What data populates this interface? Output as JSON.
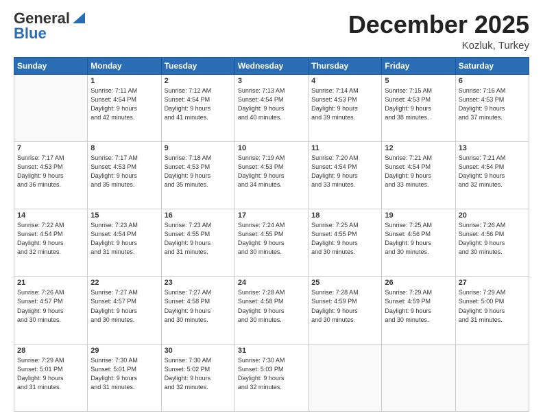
{
  "logo": {
    "line1": "General",
    "line2": "Blue"
  },
  "header": {
    "month": "December 2025",
    "location": "Kozluk, Turkey"
  },
  "weekdays": [
    "Sunday",
    "Monday",
    "Tuesday",
    "Wednesday",
    "Thursday",
    "Friday",
    "Saturday"
  ],
  "weeks": [
    [
      {
        "day": "",
        "info": ""
      },
      {
        "day": "1",
        "info": "Sunrise: 7:11 AM\nSunset: 4:54 PM\nDaylight: 9 hours\nand 42 minutes."
      },
      {
        "day": "2",
        "info": "Sunrise: 7:12 AM\nSunset: 4:54 PM\nDaylight: 9 hours\nand 41 minutes."
      },
      {
        "day": "3",
        "info": "Sunrise: 7:13 AM\nSunset: 4:54 PM\nDaylight: 9 hours\nand 40 minutes."
      },
      {
        "day": "4",
        "info": "Sunrise: 7:14 AM\nSunset: 4:53 PM\nDaylight: 9 hours\nand 39 minutes."
      },
      {
        "day": "5",
        "info": "Sunrise: 7:15 AM\nSunset: 4:53 PM\nDaylight: 9 hours\nand 38 minutes."
      },
      {
        "day": "6",
        "info": "Sunrise: 7:16 AM\nSunset: 4:53 PM\nDaylight: 9 hours\nand 37 minutes."
      }
    ],
    [
      {
        "day": "7",
        "info": "Sunrise: 7:17 AM\nSunset: 4:53 PM\nDaylight: 9 hours\nand 36 minutes."
      },
      {
        "day": "8",
        "info": "Sunrise: 7:17 AM\nSunset: 4:53 PM\nDaylight: 9 hours\nand 35 minutes."
      },
      {
        "day": "9",
        "info": "Sunrise: 7:18 AM\nSunset: 4:53 PM\nDaylight: 9 hours\nand 35 minutes."
      },
      {
        "day": "10",
        "info": "Sunrise: 7:19 AM\nSunset: 4:53 PM\nDaylight: 9 hours\nand 34 minutes."
      },
      {
        "day": "11",
        "info": "Sunrise: 7:20 AM\nSunset: 4:54 PM\nDaylight: 9 hours\nand 33 minutes."
      },
      {
        "day": "12",
        "info": "Sunrise: 7:21 AM\nSunset: 4:54 PM\nDaylight: 9 hours\nand 33 minutes."
      },
      {
        "day": "13",
        "info": "Sunrise: 7:21 AM\nSunset: 4:54 PM\nDaylight: 9 hours\nand 32 minutes."
      }
    ],
    [
      {
        "day": "14",
        "info": "Sunrise: 7:22 AM\nSunset: 4:54 PM\nDaylight: 9 hours\nand 32 minutes."
      },
      {
        "day": "15",
        "info": "Sunrise: 7:23 AM\nSunset: 4:54 PM\nDaylight: 9 hours\nand 31 minutes."
      },
      {
        "day": "16",
        "info": "Sunrise: 7:23 AM\nSunset: 4:55 PM\nDaylight: 9 hours\nand 31 minutes."
      },
      {
        "day": "17",
        "info": "Sunrise: 7:24 AM\nSunset: 4:55 PM\nDaylight: 9 hours\nand 30 minutes."
      },
      {
        "day": "18",
        "info": "Sunrise: 7:25 AM\nSunset: 4:55 PM\nDaylight: 9 hours\nand 30 minutes."
      },
      {
        "day": "19",
        "info": "Sunrise: 7:25 AM\nSunset: 4:56 PM\nDaylight: 9 hours\nand 30 minutes."
      },
      {
        "day": "20",
        "info": "Sunrise: 7:26 AM\nSunset: 4:56 PM\nDaylight: 9 hours\nand 30 minutes."
      }
    ],
    [
      {
        "day": "21",
        "info": "Sunrise: 7:26 AM\nSunset: 4:57 PM\nDaylight: 9 hours\nand 30 minutes."
      },
      {
        "day": "22",
        "info": "Sunrise: 7:27 AM\nSunset: 4:57 PM\nDaylight: 9 hours\nand 30 minutes."
      },
      {
        "day": "23",
        "info": "Sunrise: 7:27 AM\nSunset: 4:58 PM\nDaylight: 9 hours\nand 30 minutes."
      },
      {
        "day": "24",
        "info": "Sunrise: 7:28 AM\nSunset: 4:58 PM\nDaylight: 9 hours\nand 30 minutes."
      },
      {
        "day": "25",
        "info": "Sunrise: 7:28 AM\nSunset: 4:59 PM\nDaylight: 9 hours\nand 30 minutes."
      },
      {
        "day": "26",
        "info": "Sunrise: 7:29 AM\nSunset: 4:59 PM\nDaylight: 9 hours\nand 30 minutes."
      },
      {
        "day": "27",
        "info": "Sunrise: 7:29 AM\nSunset: 5:00 PM\nDaylight: 9 hours\nand 31 minutes."
      }
    ],
    [
      {
        "day": "28",
        "info": "Sunrise: 7:29 AM\nSunset: 5:01 PM\nDaylight: 9 hours\nand 31 minutes."
      },
      {
        "day": "29",
        "info": "Sunrise: 7:30 AM\nSunset: 5:01 PM\nDaylight: 9 hours\nand 31 minutes."
      },
      {
        "day": "30",
        "info": "Sunrise: 7:30 AM\nSunset: 5:02 PM\nDaylight: 9 hours\nand 32 minutes."
      },
      {
        "day": "31",
        "info": "Sunrise: 7:30 AM\nSunset: 5:03 PM\nDaylight: 9 hours\nand 32 minutes."
      },
      {
        "day": "",
        "info": ""
      },
      {
        "day": "",
        "info": ""
      },
      {
        "day": "",
        "info": ""
      }
    ]
  ]
}
